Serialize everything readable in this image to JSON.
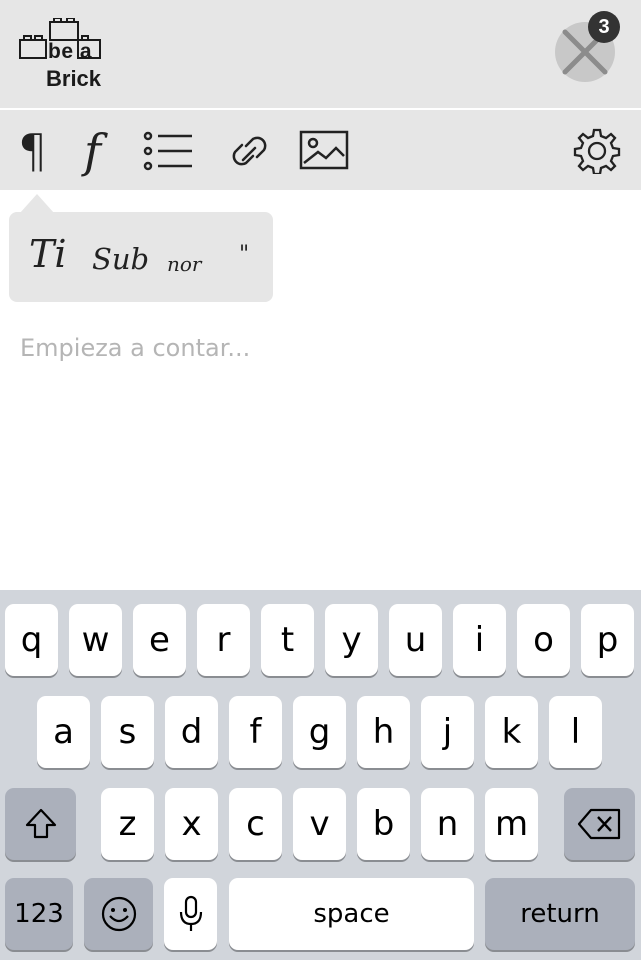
{
  "header": {
    "logo_line1": "be a",
    "logo_line2": "Brick",
    "badge_count": "3"
  },
  "toolbar": {
    "paragraph_glyph": "¶",
    "font_glyph": "f"
  },
  "style_popover": {
    "title": "Ti",
    "subtitle": "Sub",
    "normal": "nor",
    "quote": "\""
  },
  "editor": {
    "placeholder": "Empieza a contar..."
  },
  "keyboard": {
    "row1": [
      "q",
      "w",
      "e",
      "r",
      "t",
      "y",
      "u",
      "i",
      "o",
      "p"
    ],
    "row2": [
      "a",
      "s",
      "d",
      "f",
      "g",
      "h",
      "j",
      "k",
      "l"
    ],
    "row3": [
      "z",
      "x",
      "c",
      "v",
      "b",
      "n",
      "m"
    ],
    "numbers_label": "123",
    "space_label": "space",
    "return_label": "return"
  }
}
